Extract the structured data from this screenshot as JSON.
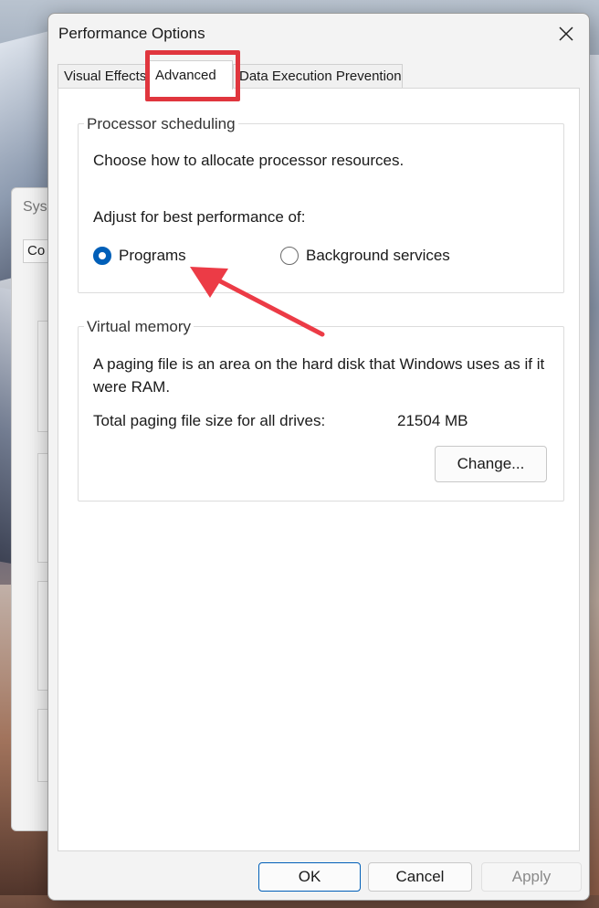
{
  "background_window": {
    "title": "Sys",
    "tab": "Co"
  },
  "dialog": {
    "title": "Performance Options"
  },
  "tabs": [
    {
      "label": "Visual Effects"
    },
    {
      "label": "Advanced"
    },
    {
      "label": "Data Execution Prevention"
    }
  ],
  "processor": {
    "legend": "Processor scheduling",
    "choose": "Choose how to allocate processor resources.",
    "adjust": "Adjust for best performance of:",
    "option_programs": "Programs",
    "option_background": "Background services"
  },
  "virtual_memory": {
    "legend": "Virtual memory",
    "description": "A paging file is an area on the hard disk that Windows uses as if it were RAM.",
    "total_label": "Total paging file size for all drives:",
    "total_value": "21504 MB",
    "change_label": "Change..."
  },
  "buttons": {
    "ok": "OK",
    "cancel": "Cancel",
    "apply": "Apply"
  },
  "colors": {
    "accent": "#005fb8",
    "highlight": "#e0363e"
  }
}
